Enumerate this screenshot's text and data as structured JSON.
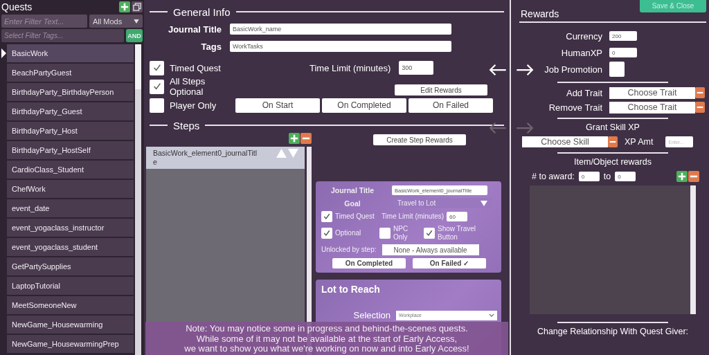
{
  "quests_panel": {
    "title": "Quests",
    "filter_text": {
      "placeholder": "Enter Filter Text..."
    },
    "mod_filter": "All Mods",
    "tag_filter": {
      "placeholder": "Select Filter Tags..."
    },
    "tag_mode_button": "AND",
    "items": [
      {
        "label": "BasicWork",
        "selected": true
      },
      {
        "label": "BeachPartyGuest",
        "selected": false
      },
      {
        "label": "BirthdayParty_BirthdayPerson",
        "selected": false
      },
      {
        "label": "BirthdayParty_Guest",
        "selected": false
      },
      {
        "label": "BirthdayParty_Host",
        "selected": false
      },
      {
        "label": "BirthdayParty_HostSelf",
        "selected": false
      },
      {
        "label": "CardioClass_Student",
        "selected": false
      },
      {
        "label": "ChefWork",
        "selected": false
      },
      {
        "label": "event_date",
        "selected": false
      },
      {
        "label": "event_yogaclass_instructor",
        "selected": false
      },
      {
        "label": "event_yogaclass_student",
        "selected": false
      },
      {
        "label": "GetPartySupplies",
        "selected": false
      },
      {
        "label": "LaptopTutorial",
        "selected": false
      },
      {
        "label": "MeetSomeoneNew",
        "selected": false
      },
      {
        "label": "NewGame_Housewarming",
        "selected": false
      },
      {
        "label": "NewGame_HousewarmingPrep",
        "selected": false
      }
    ]
  },
  "general_info": {
    "heading": "General Info",
    "journal_title": {
      "label": "Journal Title",
      "value": "BasicWork_name"
    },
    "tags": {
      "label": "Tags",
      "value": "WorkTasks"
    },
    "options": [
      {
        "label": "Timed Quest",
        "checked": true
      },
      {
        "label": "All Steps Optional",
        "checked": true
      },
      {
        "label": "Player Only",
        "checked": false
      }
    ],
    "time_limit": {
      "label": "Time Limit (minutes)",
      "value": "300"
    },
    "edit_rewards_button": "Edit Rewards",
    "event_buttons": [
      "On Start",
      "On Completed",
      "On Failed"
    ]
  },
  "steps": {
    "heading": "Steps",
    "items": [
      {
        "label": "BasicWork_element0_journalTitle",
        "selected": true
      }
    ],
    "create_step_rewards_button": "Create Step Rewards",
    "step_detail": {
      "journal_title": {
        "label": "Journal Title",
        "value": "BasicWork_element0_journalTitle"
      },
      "goal": {
        "label": "Goal",
        "value": "Travel to Lot"
      },
      "options": [
        {
          "label": "Timed Quest",
          "checked": true
        },
        {
          "label": "Optional",
          "checked": true
        },
        {
          "label": "NPC Only",
          "checked": false
        },
        {
          "label": "Show Travel Button",
          "checked": true
        }
      ],
      "time_limit": {
        "label": "Time Limit (minutes)",
        "value": "60"
      },
      "unlocked_by": {
        "label": "Unlocked by step:",
        "value": "None - Always available"
      },
      "event_buttons": [
        "On Completed",
        "On Failed ✓"
      ]
    },
    "lot_to_reach": {
      "heading": "Lot to Reach",
      "selection": {
        "label": "Selection",
        "value": "Workplace"
      }
    }
  },
  "note": [
    "Note: You may notice some in progress and behind-the-scenes quests.",
    "While some of it may not be available at the start of Early Access,",
    "we want to show you what we're working on now and into Early Access!"
  ],
  "rewards": {
    "heading": "Rewards",
    "save_button": "Save & Close",
    "currency": {
      "label": "Currency",
      "value": "200"
    },
    "human_xp": {
      "label": "HumanXP",
      "value": "0"
    },
    "job_promotion": {
      "label": "Job Promotion",
      "checked": false
    },
    "add_trait": {
      "label": "Add Trait",
      "value": "Choose Trait"
    },
    "remove_trait": {
      "label": "Remove Trait",
      "value": "Choose Trait"
    },
    "grant_skill_xp": {
      "heading": "Grant Skill XP",
      "skill": "Choose Skill",
      "amount_label": "XP Amt",
      "amount": {
        "placeholder": "Enter..."
      }
    },
    "items": {
      "heading": "Item/Object rewards",
      "count_label": "# to award:",
      "min": "0",
      "to_label": "to",
      "max": "0"
    },
    "relationship_heading": "Change Relationship With Quest Giver:"
  }
}
